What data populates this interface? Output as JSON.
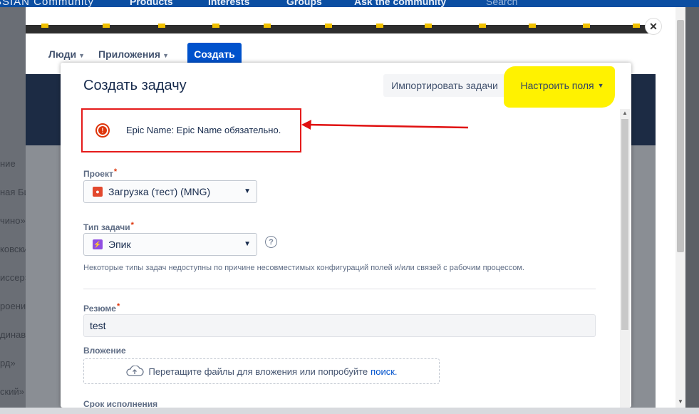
{
  "community_bar": {
    "logo": "SSIAN Community",
    "products": "Products",
    "interests": "Interests",
    "groups": "Groups",
    "ask": "Ask the community",
    "search": "Search"
  },
  "background": {
    "rows": [
      "ние",
      "ная Битв",
      "чино»",
      "ковский",
      "иссер»",
      "роение",
      "динавск",
      "рд»",
      "ский»"
    ]
  },
  "jira_nav": {
    "people": "Люди",
    "apps": "Приложения",
    "create": "Создать"
  },
  "dialog": {
    "title": "Создать задачу",
    "import_button": "Импортировать задачи",
    "configure_button": "Настроить поля",
    "error_message": "Epic Name: Epic Name обязательно.",
    "project": {
      "label": "Проект",
      "value": "Загрузка (тест) (MNG)"
    },
    "issue_type": {
      "label": "Тип задачи",
      "value": "Эпик",
      "hint": "Некоторые типы задач недоступны по причине несовместимых конфигураций полей и/или связей с рабочим процессом."
    },
    "summary": {
      "label": "Резюме",
      "value": "test"
    },
    "attachment": {
      "label": "Вложение",
      "drop_text": "Перетащите файлы для вложения или попробуйте",
      "link_text": "поиск."
    },
    "due_date": {
      "label": "Срок исполнения"
    }
  },
  "colors": {
    "accent": "#0052cc",
    "error": "#de350b",
    "highlight": "#fff200"
  }
}
